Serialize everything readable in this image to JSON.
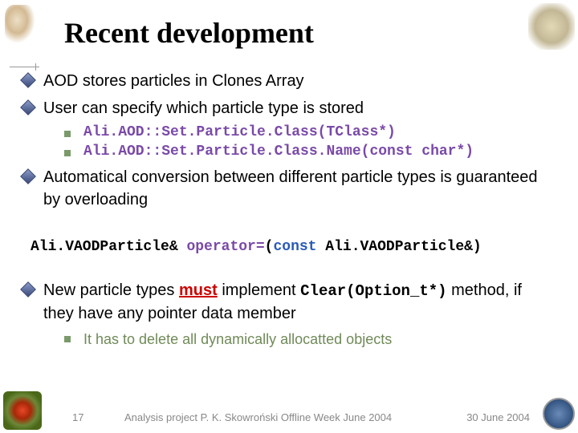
{
  "title": "Recent development",
  "bullets": {
    "b1": "AOD stores particles in Clones Array",
    "b2": "User can specify which particle type is stored",
    "b3": "Automatical conversion between different particle types is guaranteed by overloading",
    "b4_pre": "New particle types ",
    "b4_must": "must",
    "b4_mid": " implement ",
    "b4_code": "Clear(Option_t*)",
    "b4_post": " method, if they have any pointer data member"
  },
  "subs": {
    "s1": "Ali.AOD::Set.Particle.Class(TClass*)",
    "s2": "Ali.AOD::Set.Particle.Class.Name(const char*)",
    "s3": "It has to delete all dynamically allocatted objects"
  },
  "code": {
    "left": "Ali.VAODParticle& ",
    "op": "operator=",
    "mid": "(",
    "kw": "const",
    "right": " Ali.VAODParticle&)"
  },
  "footer": {
    "page": "17",
    "center": "Analysis project  P. K. Skowroński   Offline Week June 2004",
    "date": "30 June 2004"
  }
}
